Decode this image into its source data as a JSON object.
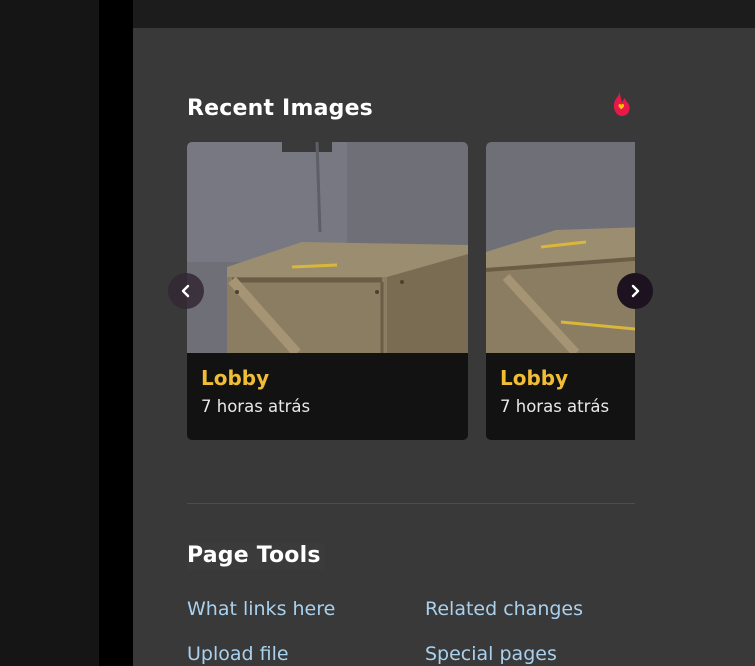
{
  "recent_images": {
    "title": "Recent Images",
    "items": [
      {
        "title": "Lobby",
        "time": "7 horas atrás"
      },
      {
        "title": "Lobby",
        "time": "7 horas atrás"
      }
    ]
  },
  "page_tools": {
    "title": "Page Tools",
    "links": [
      "What links here",
      "Related changes",
      "Upload file",
      "Special pages"
    ]
  },
  "colors": {
    "accent_title": "#f0bd34",
    "link": "#a9d1ee",
    "panel_bg": "#393939",
    "card_bg": "#121212"
  },
  "icons": [
    "fandom-flame-icon",
    "chevron-left-icon",
    "chevron-right-icon"
  ]
}
